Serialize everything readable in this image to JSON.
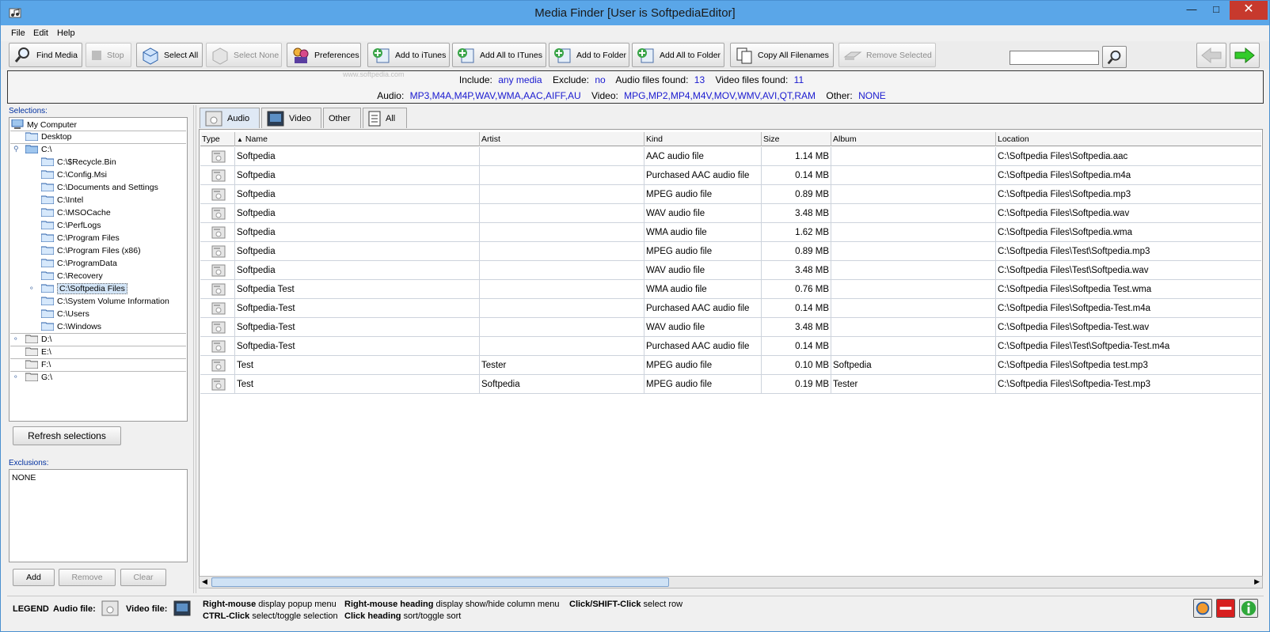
{
  "window": {
    "title": "Media Finder [User is SoftpediaEditor]",
    "controls": {
      "minimize": "—",
      "maximize": "□",
      "close": "✕"
    }
  },
  "menu": [
    "File",
    "Edit",
    "Help"
  ],
  "toolbar": {
    "find_media": "Find Media",
    "stop": "Stop",
    "select_all": "Select All",
    "select_none": "Select None",
    "preferences": "Preferences",
    "add_to_itunes": "Add to iTunes",
    "add_all_to_itunes": "Add All to ITunes",
    "add_to_folder": "Add to Folder",
    "add_all_to_folder": "Add All to Folder",
    "copy_all_filenames": "Copy All Filenames",
    "remove_selected": "Remove Selected",
    "search_value": ""
  },
  "info": {
    "include_label": "Include:",
    "include_value": "any media",
    "exclude_label": "Exclude:",
    "exclude_value": "no",
    "audio_found_label": "Audio files found:",
    "audio_found_value": "13",
    "video_found_label": "Video files found:",
    "video_found_value": "11",
    "audio_label": "Audio:",
    "audio_value": "MP3,M4A,M4P,WAV,WMA,AAC,AIFF,AU",
    "video_label": "Video:",
    "video_value": "MPG,MP2,MP4,M4V,MOV,WMV,AVI,QT,RAM",
    "other_label": "Other:",
    "other_value": "NONE",
    "watermark": "www.softpedia.com"
  },
  "selections": {
    "label": "Selections:",
    "root": "My Computer",
    "desktop": "Desktop",
    "c_drive": "C:\\",
    "c_folders": [
      "C:\\$Recycle.Bin",
      "C:\\Config.Msi",
      "C:\\Documents and Settings",
      "C:\\Intel",
      "C:\\MSOCache",
      "C:\\PerfLogs",
      "C:\\Program Files",
      "C:\\Program Files (x86)",
      "C:\\ProgramData",
      "C:\\Recovery",
      "C:\\Softpedia Files",
      "C:\\System Volume Information",
      "C:\\Users",
      "C:\\Windows"
    ],
    "selected_folder": "C:\\Softpedia Files",
    "other_drives": [
      "D:\\",
      "E:\\",
      "F:\\",
      "G:\\"
    ],
    "refresh_button": "Refresh selections"
  },
  "exclusions": {
    "label": "Exclusions:",
    "value": "NONE",
    "add": "Add",
    "remove": "Remove",
    "clear": "Clear"
  },
  "tabs": [
    "Audio",
    "Video",
    "Other",
    "All"
  ],
  "active_tab": "Audio",
  "table": {
    "sort_indicator": "▲",
    "columns": [
      "Type",
      "Name",
      "Artist",
      "Kind",
      "Size",
      "Album",
      "Location"
    ],
    "rows": [
      {
        "name": "Softpedia",
        "artist": "",
        "kind": "AAC audio file",
        "size": "1.14 MB",
        "album": "",
        "location": "C:\\Softpedia Files\\Softpedia.aac"
      },
      {
        "name": "Softpedia",
        "artist": "",
        "kind": "Purchased AAC audio file",
        "size": "0.14 MB",
        "album": "",
        "location": "C:\\Softpedia Files\\Softpedia.m4a"
      },
      {
        "name": "Softpedia",
        "artist": "",
        "kind": "MPEG audio file",
        "size": "0.89 MB",
        "album": "",
        "location": "C:\\Softpedia Files\\Softpedia.mp3"
      },
      {
        "name": "Softpedia",
        "artist": "",
        "kind": "WAV audio file",
        "size": "3.48 MB",
        "album": "",
        "location": "C:\\Softpedia Files\\Softpedia.wav"
      },
      {
        "name": "Softpedia",
        "artist": "",
        "kind": "WMA audio file",
        "size": "1.62 MB",
        "album": "",
        "location": "C:\\Softpedia Files\\Softpedia.wma"
      },
      {
        "name": "Softpedia",
        "artist": "",
        "kind": "MPEG audio file",
        "size": "0.89 MB",
        "album": "",
        "location": "C:\\Softpedia Files\\Test\\Softpedia.mp3"
      },
      {
        "name": "Softpedia",
        "artist": "",
        "kind": "WAV audio file",
        "size": "3.48 MB",
        "album": "",
        "location": "C:\\Softpedia Files\\Test\\Softpedia.wav"
      },
      {
        "name": "Softpedia Test",
        "artist": "",
        "kind": "WMA audio file",
        "size": "0.76 MB",
        "album": "",
        "location": "C:\\Softpedia Files\\Softpedia Test.wma"
      },
      {
        "name": "Softpedia-Test",
        "artist": "",
        "kind": "Purchased AAC audio file",
        "size": "0.14 MB",
        "album": "",
        "location": "C:\\Softpedia Files\\Softpedia-Test.m4a"
      },
      {
        "name": "Softpedia-Test",
        "artist": "",
        "kind": "WAV audio file",
        "size": "3.48 MB",
        "album": "",
        "location": "C:\\Softpedia Files\\Softpedia-Test.wav"
      },
      {
        "name": "Softpedia-Test",
        "artist": "",
        "kind": "Purchased AAC audio file",
        "size": "0.14 MB",
        "album": "",
        "location": "C:\\Softpedia Files\\Test\\Softpedia-Test.m4a"
      },
      {
        "name": "Test",
        "artist": "Tester",
        "kind": "MPEG audio file",
        "size": "0.10 MB",
        "album": "Softpedia",
        "location": "C:\\Softpedia Files\\Softpedia test.mp3"
      },
      {
        "name": "Test",
        "artist": "Softpedia",
        "kind": "MPEG audio file",
        "size": "0.19 MB",
        "album": "Tester",
        "location": "C:\\Softpedia Files\\Softpedia-Test.mp3"
      }
    ]
  },
  "legend": {
    "title": "LEGEND",
    "audio_file": "Audio file:",
    "video_file": "Video file:",
    "rm_bold": "Right-mouse",
    "rm_text": "display popup menu",
    "ctrl_bold": "CTRL-Click",
    "ctrl_text": "select/toggle selection",
    "rmh_bold": "Right-mouse heading",
    "rmh_text": "display show/hide column menu",
    "ch_bold": "Click heading",
    "ch_text": "sort/toggle sort",
    "cs_bold": "Click/SHIFT-Click",
    "cs_text": "select row"
  },
  "colors": {
    "titlebar": "#5aa6e8",
    "close": "#c7392d",
    "info_value": "#1a1ad0",
    "label_blue": "#0030a0",
    "selected": "#d3e5f7"
  }
}
